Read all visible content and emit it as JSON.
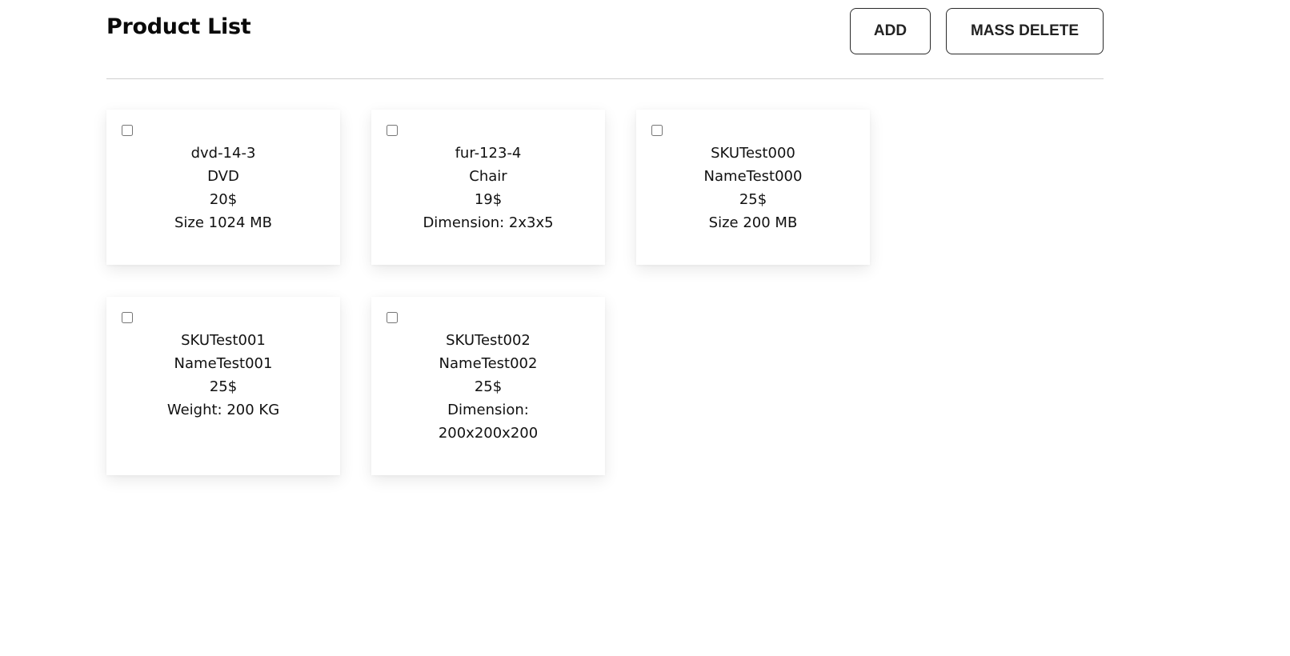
{
  "header": {
    "title": "Product List",
    "add_label": "ADD",
    "mass_delete_label": "MASS DELETE"
  },
  "products": [
    {
      "sku": "dvd-14-3",
      "name": "DVD",
      "price": "20$",
      "attribute": "Size 1024 MB",
      "selected": false
    },
    {
      "sku": "fur-123-4",
      "name": "Chair",
      "price": "19$",
      "attribute": "Dimension: 2x3x5",
      "selected": false
    },
    {
      "sku": "SKUTest000",
      "name": "NameTest000",
      "price": "25$",
      "attribute": "Size 200 MB",
      "selected": false
    },
    {
      "sku": "SKUTest001",
      "name": "NameTest001",
      "price": "25$",
      "attribute": "Weight: 200 KG",
      "selected": false
    },
    {
      "sku": "SKUTest002",
      "name": "NameTest002",
      "price": "25$",
      "attribute": "Dimension: 200x200x200",
      "selected": false
    }
  ]
}
